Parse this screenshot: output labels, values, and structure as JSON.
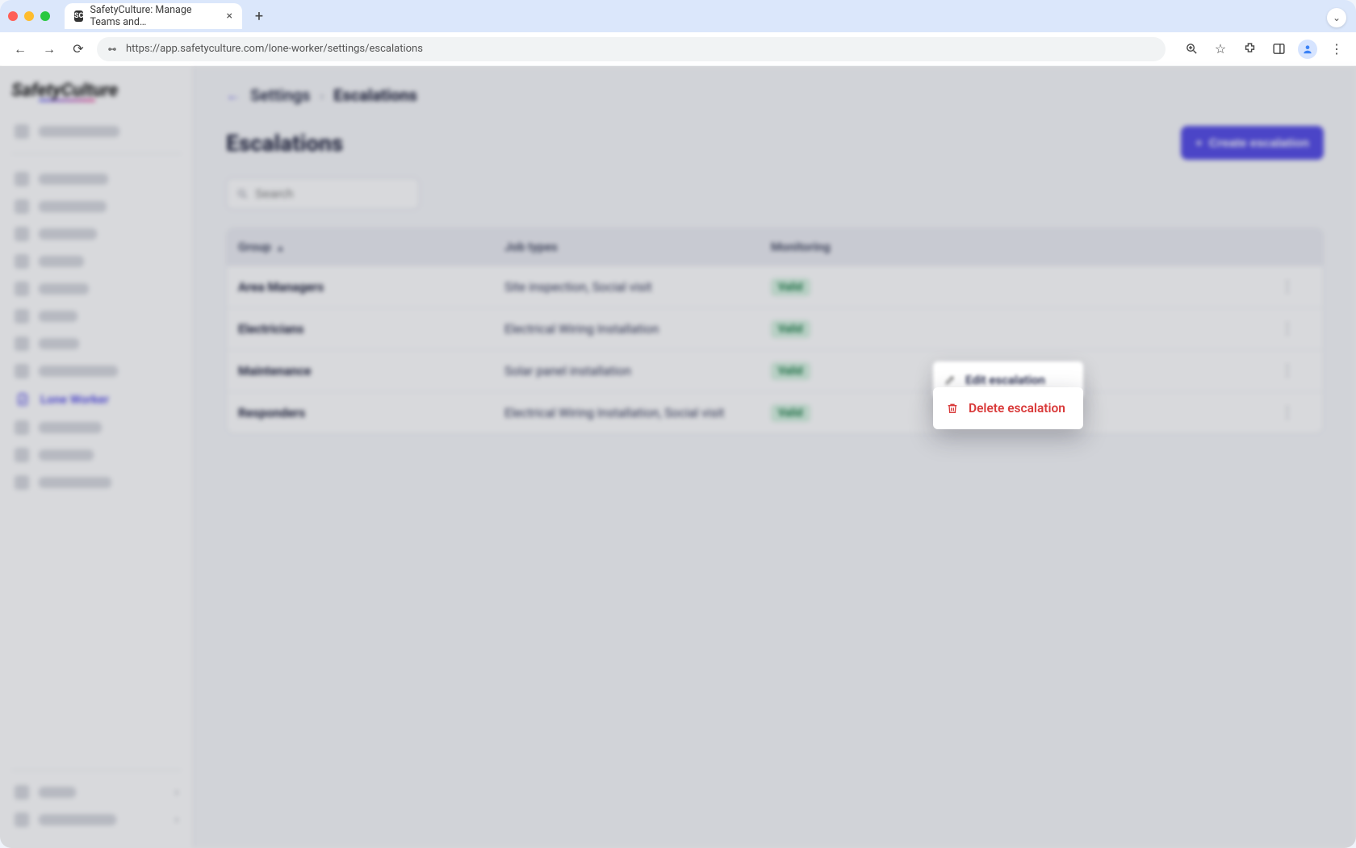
{
  "browser": {
    "tab_title": "SafetyCulture: Manage Teams and…",
    "url": "https://app.safetyculture.com/lone-worker/settings/escalations"
  },
  "sidebar": {
    "logo_text": "SafetyCulture",
    "active_item_label": "Lone Worker"
  },
  "breadcrumb": {
    "parent": "Settings",
    "current": "Escalations"
  },
  "page": {
    "title": "Escalations",
    "create_button": "Create escalation",
    "search_placeholder": "Search"
  },
  "table": {
    "headers": {
      "group": "Group",
      "job_types": "Job types",
      "monitoring": "Monitoring"
    },
    "rows": [
      {
        "group": "Area Managers",
        "job_types": "Site inspection, Social visit",
        "monitoring": "Valid"
      },
      {
        "group": "Electricians",
        "job_types": "Electrical Wiring Installation",
        "monitoring": "Valid"
      },
      {
        "group": "Maintenance",
        "job_types": "Solar panel installation",
        "monitoring": "Valid"
      },
      {
        "group": "Responders",
        "job_types": "Electrical Wiring Installation, Social visit",
        "monitoring": "Valid"
      }
    ]
  },
  "context_menu": {
    "edit": "Edit escalation",
    "delete": "Delete escalation"
  },
  "colors": {
    "primary": "#4f46e5",
    "danger": "#d93a3a",
    "valid_bg": "#d6f3e1",
    "valid_fg": "#177a43"
  }
}
